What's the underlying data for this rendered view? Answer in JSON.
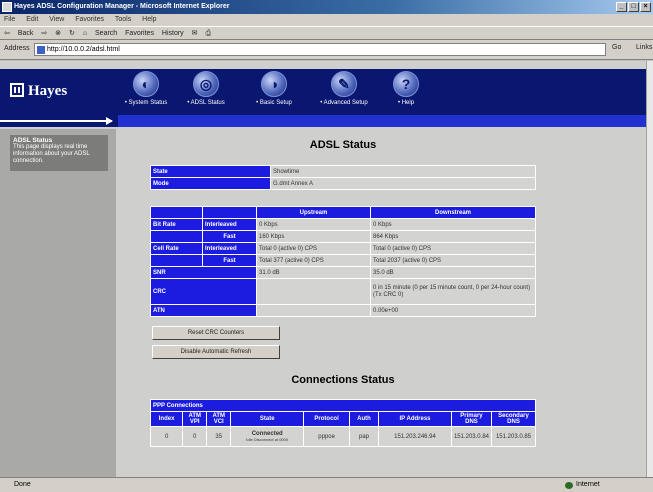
{
  "window": {
    "title": "Hayes ADSL Configuration Manager - Microsoft Internet Explorer"
  },
  "menubar": [
    "File",
    "Edit",
    "View",
    "Favorites",
    "Tools",
    "Help"
  ],
  "toolbar": {
    "back": "Back",
    "search": "Search",
    "favorites": "Favorites",
    "history": "History"
  },
  "address": {
    "label": "Address",
    "url": "http://10.0.0.2/adsl.html",
    "go": "Go",
    "links": "Links"
  },
  "banner": {
    "logo": "Hayes",
    "nav": [
      {
        "label": "• System Status",
        "glyph": "◐"
      },
      {
        "label": "• ADSL Status",
        "glyph": "◎"
      },
      {
        "label": "• Basic Setup",
        "glyph": "◑"
      },
      {
        "label": "• Advanced Setup",
        "glyph": "✎"
      },
      {
        "label": "• Help",
        "glyph": "?"
      }
    ]
  },
  "sidebar": {
    "title": "ADSL Status",
    "text": "This page displays real time information about your ADSL connection."
  },
  "adsl": {
    "heading": "ADSL Status",
    "state_label": "State",
    "state_value": "Showtime",
    "mode_label": "Mode",
    "mode_value": "G.dmt Annex A",
    "col_upstream": "Upstream",
    "col_downstream": "Downstream",
    "bitrate_label": "Bit Rate",
    "interleaved": "Interleaved",
    "fast": "Fast",
    "bitrate_int_up": "0 Kbps",
    "bitrate_int_down": "0 Kbps",
    "bitrate_fast_up": "160 Kbps",
    "bitrate_fast_down": "864 Kbps",
    "cellrate_label": "Cell Rate",
    "cell_int_up": "Total 0 (active 0) CPS",
    "cell_int_down": "Total 0 (active 0) CPS",
    "cell_fast_up": "Total 377 (active 0) CPS",
    "cell_fast_down": "Total 2037 (active 0) CPS",
    "snr_label": "SNR",
    "snr_up": "31.0 dB",
    "snr_down": "35.0 dB",
    "crc_label": "CRC",
    "crc_up": "",
    "crc_down": "0 in 15 minute (0 per 15 minute count, 0 per 24-hour count) (Tx CRC 0)",
    "atten_label": "ATN",
    "atten_up": "",
    "atten_down": "0.00e+00"
  },
  "buttons": {
    "reset_crc": "Reset CRC Counters",
    "disable_refresh": "Disable Automatic Refresh"
  },
  "connections": {
    "heading": "Connections Status",
    "section": "PPP Connections",
    "headers": [
      "Index",
      "ATM VPI",
      "ATM VCI",
      "State",
      "Protocol",
      "Auth",
      "IP Address",
      "Primary DNS",
      "Secondary DNS"
    ],
    "rows": [
      {
        "index": "0",
        "vpi": "0",
        "vci": "35",
        "state": "Connected",
        "state_sub": "Idle Disconnect at 0000",
        "protocol": "pppoe",
        "auth": "pap",
        "ip": "151.203.246.94",
        "dns1": "151.203.0.84",
        "dns2": "151.203.0.85"
      }
    ]
  },
  "statusbar": {
    "left": "Done",
    "zone": "Internet"
  },
  "colors": {
    "banner": "#0a1770",
    "table_header": "#1c1ce0",
    "cell": "#d3d3d1"
  }
}
